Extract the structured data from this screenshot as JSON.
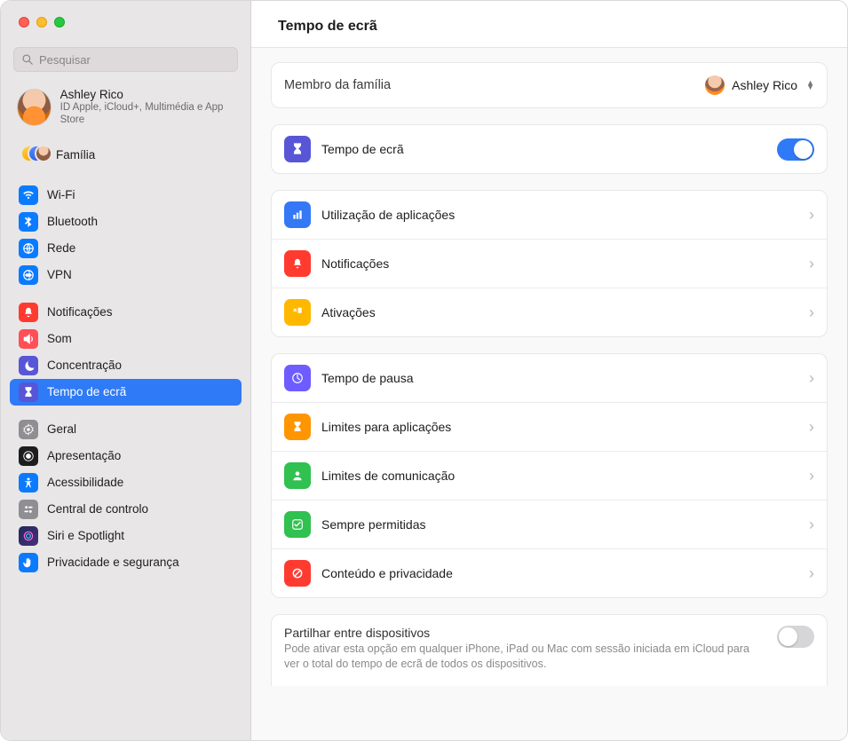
{
  "header": {
    "title": "Tempo de ecrã"
  },
  "search": {
    "placeholder": "Pesquisar"
  },
  "account": {
    "name": "Ashley Rico",
    "subtitle": "ID Apple, iCloud+, Multimédia e App Store"
  },
  "family_link": {
    "label": "Família"
  },
  "sidebar": {
    "groups": [
      [
        {
          "label": "Wi-Fi",
          "icon": "wifi",
          "bg": "bg-blue"
        },
        {
          "label": "Bluetooth",
          "icon": "bluetooth",
          "bg": "bg-blue"
        },
        {
          "label": "Rede",
          "icon": "network",
          "bg": "bg-blue"
        },
        {
          "label": "VPN",
          "icon": "vpn",
          "bg": "bg-blue"
        }
      ],
      [
        {
          "label": "Notificações",
          "icon": "bell",
          "bg": "bg-red"
        },
        {
          "label": "Som",
          "icon": "sound",
          "bg": "bg-redpnk"
        },
        {
          "label": "Concentração",
          "icon": "moon",
          "bg": "bg-indigo"
        },
        {
          "label": "Tempo de ecrã",
          "icon": "hourglass",
          "bg": "bg-indigo",
          "selected": true
        }
      ],
      [
        {
          "label": "Geral",
          "icon": "gear",
          "bg": "bg-gray"
        },
        {
          "label": "Apresentação",
          "icon": "display",
          "bg": "bg-black"
        },
        {
          "label": "Acessibilidade",
          "icon": "access",
          "bg": "bg-blue"
        },
        {
          "label": "Central de controlo",
          "icon": "controls",
          "bg": "bg-gray"
        },
        {
          "label": "Siri e Spotlight",
          "icon": "siri",
          "bg": "bg-siri"
        },
        {
          "label": "Privacidade e segurança",
          "icon": "hand",
          "bg": "bg-blue"
        }
      ]
    ]
  },
  "family_member": {
    "label": "Membro da família",
    "value": "Ashley Rico"
  },
  "screen_time_toggle": {
    "label": "Tempo de ecrã",
    "on": true
  },
  "usage_group": [
    {
      "label": "Utilização de aplicações",
      "icon": "chart",
      "bg": "bg-blue2"
    },
    {
      "label": "Notificações",
      "icon": "bell",
      "bg": "bg-red"
    },
    {
      "label": "Ativações",
      "icon": "pickup",
      "bg": "bg-yellow"
    }
  ],
  "limits_group": [
    {
      "label": "Tempo de pausa",
      "icon": "downtime",
      "bg": "bg-purple"
    },
    {
      "label": "Limites para aplicações",
      "icon": "hourglass",
      "bg": "bg-orange"
    },
    {
      "label": "Limites de comunicação",
      "icon": "person",
      "bg": "bg-green"
    },
    {
      "label": "Sempre permitidas",
      "icon": "check",
      "bg": "bg-green"
    },
    {
      "label": "Conteúdo e privacidade",
      "icon": "prohibit",
      "bg": "bg-red"
    }
  ],
  "share": {
    "title": "Partilhar entre dispositivos",
    "desc": "Pode ativar esta opção em qualquer iPhone, iPad ou Mac com sessão iniciada em iCloud para ver o total do tempo de ecrã de todos os dispositivos.",
    "on": false
  }
}
